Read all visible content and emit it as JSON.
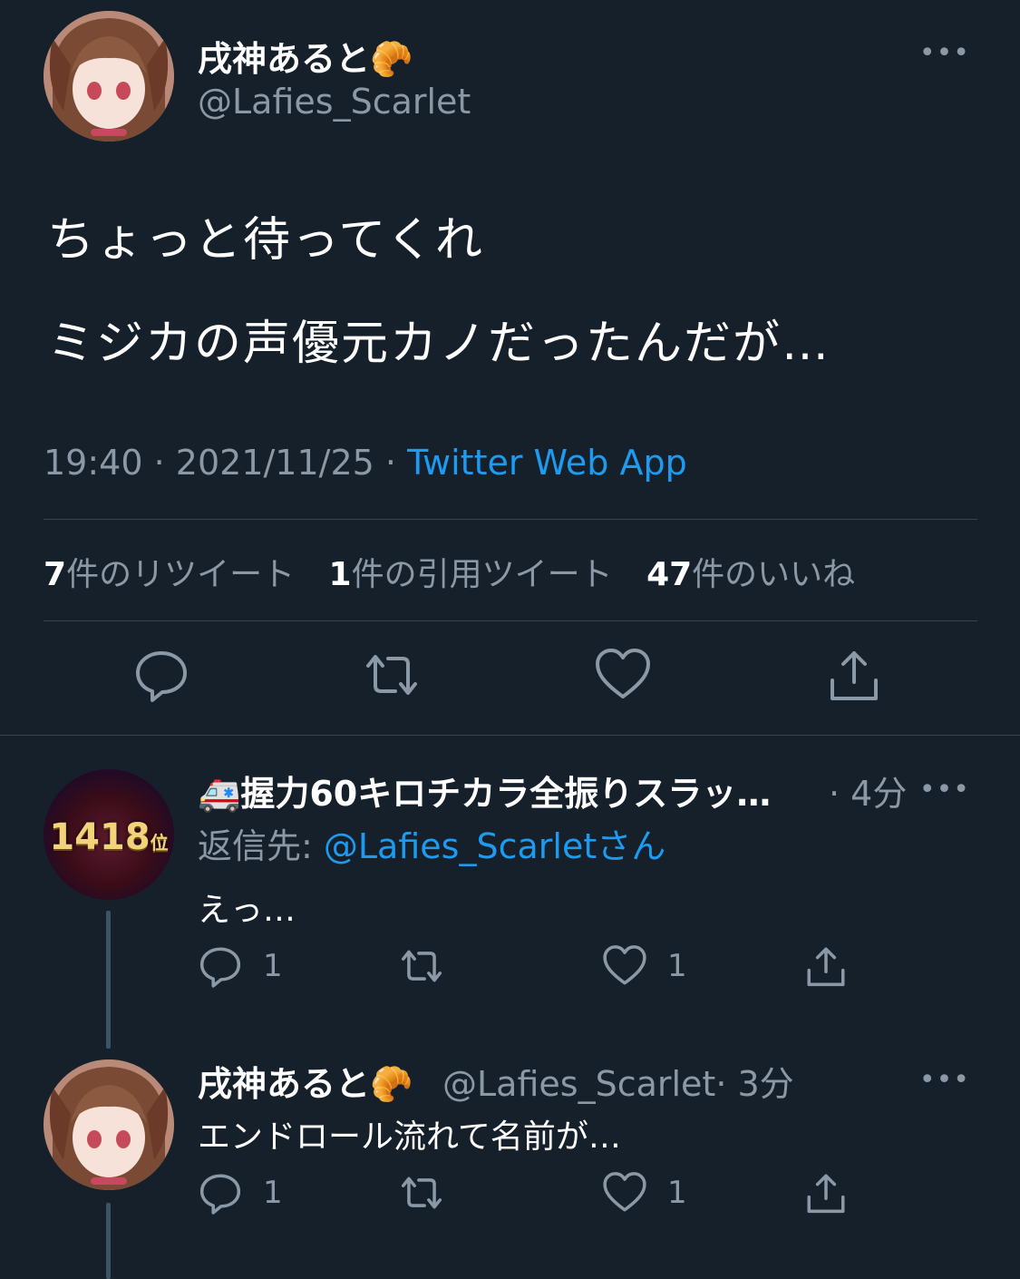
{
  "main_tweet": {
    "display_name": "戌神あると",
    "name_emoji": "🥐",
    "handle": "@Lafies_Scarlet",
    "more": "•••",
    "lines": [
      "ちょっと待ってくれ",
      "ミジカの声優元カノだったんだが…"
    ],
    "time": "19:40",
    "date": "2021/11/25",
    "sep": "·",
    "source": "Twitter Web App",
    "stats": {
      "retweets_num": "7",
      "retweets_label": "件のリツイート",
      "quotes_num": "1",
      "quotes_label": "件の引用ツイート",
      "likes_num": "47",
      "likes_label": "件のいいね"
    }
  },
  "replies": [
    {
      "display_name": "握力60キロチカラ全振りスラッ…",
      "name_emoji": "🚑",
      "time": "· 4分",
      "reply_to_label": "返信先: ",
      "reply_to_mention": "@Lafies_Scarletさん",
      "text": "えっ…",
      "avatar_badge": "1418",
      "avatar_badge_suffix": "位",
      "reply_count": "1",
      "like_count": "1",
      "more": "•••"
    },
    {
      "display_name": "戌神あると",
      "name_emoji": "🥐",
      "handle": "@Lafies_Scarlet",
      "time": "· 3分",
      "text": "エンドロール流れて名前が…",
      "reply_count": "1",
      "like_count": "1",
      "more": "•••"
    }
  ],
  "colors": {
    "background": "#15202b",
    "secondary_text": "#8b98a5",
    "accent": "#1d9bf0",
    "divider": "#38444d"
  }
}
